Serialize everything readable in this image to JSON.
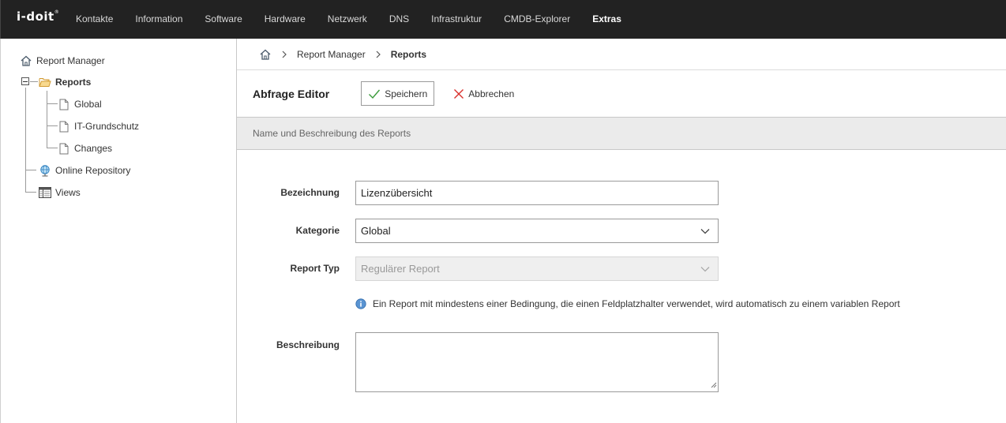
{
  "app": {
    "logo_text": "i-doit",
    "logo_mark": "®"
  },
  "nav": {
    "items": [
      {
        "label": "Kontakte"
      },
      {
        "label": "Information"
      },
      {
        "label": "Software"
      },
      {
        "label": "Hardware"
      },
      {
        "label": "Netzwerk"
      },
      {
        "label": "DNS"
      },
      {
        "label": "Infrastruktur"
      },
      {
        "label": "CMDB-Explorer"
      },
      {
        "label": "Extras"
      }
    ],
    "active": "Extras"
  },
  "sidebar": {
    "root": {
      "label": "Report Manager",
      "icon": "home-icon"
    },
    "reports": {
      "label": "Reports",
      "icon": "folder-open-icon",
      "expander_icon": "collapse-minus-icon"
    },
    "children": [
      {
        "label": "Global",
        "icon": "document-icon"
      },
      {
        "label": "IT-Grundschutz",
        "icon": "document-icon"
      },
      {
        "label": "Changes",
        "icon": "document-icon"
      }
    ],
    "online_repository": {
      "label": "Online Repository",
      "icon": "globe-icon"
    },
    "views": {
      "label": "Views",
      "icon": "table-view-icon"
    }
  },
  "breadcrumb": {
    "home_icon": "home-icon",
    "items": [
      {
        "label": "Report Manager"
      },
      {
        "label": "Reports"
      }
    ]
  },
  "toolbar": {
    "title": "Abfrage Editor",
    "save_label": "Speichern",
    "cancel_label": "Abbrechen"
  },
  "section": {
    "title": "Name und Beschreibung des Reports"
  },
  "form": {
    "bezeichnung": {
      "label": "Bezeichnung",
      "value": "Lizenzübersicht"
    },
    "kategorie": {
      "label": "Kategorie",
      "value": "Global"
    },
    "report_typ": {
      "label": "Report Typ",
      "value": "Regulärer Report",
      "disabled": true
    },
    "info_text": "Ein Report mit mindestens einer Bedingung, die einen Feldplatzhalter verwendet, wird automatisch zu einem variablen Report",
    "beschreibung": {
      "label": "Beschreibung",
      "value": ""
    }
  },
  "colors": {
    "topbar_bg": "#222222",
    "section_bg": "#ebebeb",
    "save_check": "#3a9a3a",
    "cancel_x": "#d9302c",
    "info_blue": "#3d7fc4"
  }
}
